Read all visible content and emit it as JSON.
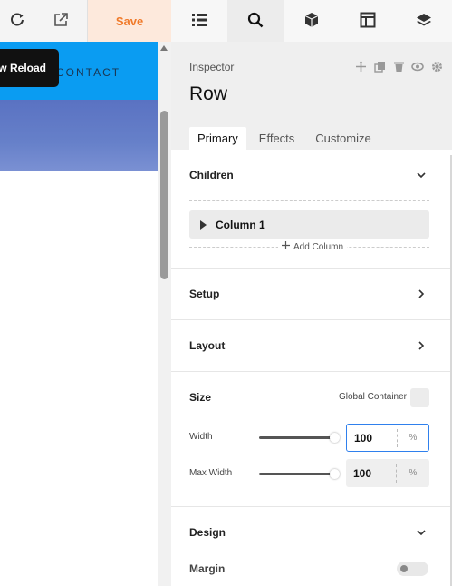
{
  "toolbar": {
    "save_label": "Save"
  },
  "preview": {
    "contact_text": "CONTACT",
    "tooltip_text": "Preview Reload"
  },
  "top_tabs": [
    {
      "icon": "list-icon"
    },
    {
      "icon": "search-icon",
      "active": true
    },
    {
      "icon": "cube-icon"
    },
    {
      "icon": "layout-icon"
    },
    {
      "icon": "layers-icon"
    }
  ],
  "inspector": {
    "label": "Inspector",
    "title": "Row",
    "header_icons": [
      "move-icon",
      "duplicate-icon",
      "delete-icon",
      "visibility-icon",
      "settings-icon"
    ],
    "tabs": [
      {
        "label": "Primary",
        "active": true
      },
      {
        "label": "Effects"
      },
      {
        "label": "Customize"
      }
    ]
  },
  "sections": {
    "children": {
      "title": "Children",
      "items": [
        {
          "label": "Column 1"
        }
      ],
      "add_label": "Add Column"
    },
    "setup": {
      "title": "Setup"
    },
    "layout": {
      "title": "Layout"
    },
    "size": {
      "title": "Size",
      "global_container_label": "Global Container",
      "width": {
        "label": "Width",
        "value": "100",
        "unit": "%",
        "slider_fraction": 1.0
      },
      "max_width": {
        "label": "Max Width",
        "value": "100",
        "unit": "%",
        "slider_fraction": 1.0
      }
    },
    "design": {
      "title": "Design",
      "margin_label": "Margin",
      "margin_enabled": false
    }
  },
  "colors": {
    "accent_orange": "#f07a2a",
    "header_blue": "#0a9cf2",
    "focus_blue": "#2f80ed"
  }
}
